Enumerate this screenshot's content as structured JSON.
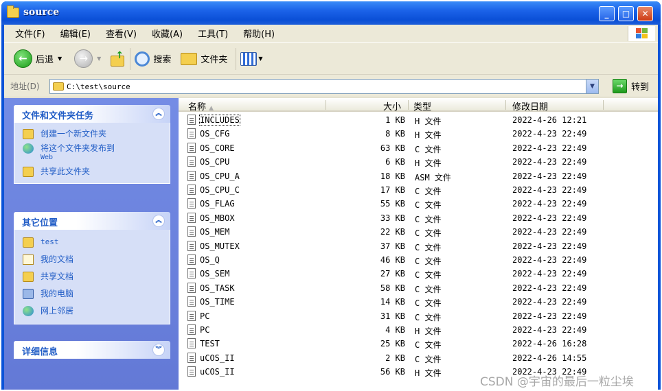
{
  "window": {
    "title": "source",
    "controls": [
      "minimize",
      "maximize",
      "close"
    ]
  },
  "menu": {
    "items": [
      "文件(F)",
      "编辑(E)",
      "查看(V)",
      "收藏(A)",
      "工具(T)",
      "帮助(H)"
    ]
  },
  "toolbar": {
    "back_label": "后退",
    "search_label": "搜索",
    "folders_label": "文件夹"
  },
  "address": {
    "label": "地址(D)",
    "path": "C:\\test\\source",
    "go_label": "转到"
  },
  "tasks_panel": {
    "title": "文件和文件夹任务",
    "items": [
      {
        "label": "创建一个新文件夹",
        "icon": "new-folder-icon"
      },
      {
        "label": "将这个文件夹发布到",
        "sub": "Web",
        "icon": "publish-web-icon"
      },
      {
        "label": "共享此文件夹",
        "icon": "share-folder-icon"
      }
    ]
  },
  "places_panel": {
    "title": "其它位置",
    "items": [
      {
        "label": "test",
        "icon": "folder-icon"
      },
      {
        "label": "我的文档",
        "icon": "documents-icon"
      },
      {
        "label": "共享文档",
        "icon": "folder-icon"
      },
      {
        "label": "我的电脑",
        "icon": "computer-icon"
      },
      {
        "label": "网上邻居",
        "icon": "network-icon"
      }
    ]
  },
  "details_panel": {
    "title": "详细信息"
  },
  "columns": {
    "name": "名称",
    "size": "大小",
    "type": "类型",
    "modified": "修改日期"
  },
  "files": [
    {
      "name": "INCLUDES",
      "size": "1 KB",
      "type": "H 文件",
      "modified": "2022-4-26 12:21"
    },
    {
      "name": "OS_CFG",
      "size": "8 KB",
      "type": "H 文件",
      "modified": "2022-4-23 22:49"
    },
    {
      "name": "OS_CORE",
      "size": "63 KB",
      "type": "C 文件",
      "modified": "2022-4-23 22:49"
    },
    {
      "name": "OS_CPU",
      "size": "6 KB",
      "type": "H 文件",
      "modified": "2022-4-23 22:49"
    },
    {
      "name": "OS_CPU_A",
      "size": "18 KB",
      "type": "ASM 文件",
      "modified": "2022-4-23 22:49"
    },
    {
      "name": "OS_CPU_C",
      "size": "17 KB",
      "type": "C 文件",
      "modified": "2022-4-23 22:49"
    },
    {
      "name": "OS_FLAG",
      "size": "55 KB",
      "type": "C 文件",
      "modified": "2022-4-23 22:49"
    },
    {
      "name": "OS_MBOX",
      "size": "33 KB",
      "type": "C 文件",
      "modified": "2022-4-23 22:49"
    },
    {
      "name": "OS_MEM",
      "size": "22 KB",
      "type": "C 文件",
      "modified": "2022-4-23 22:49"
    },
    {
      "name": "OS_MUTEX",
      "size": "37 KB",
      "type": "C 文件",
      "modified": "2022-4-23 22:49"
    },
    {
      "name": "OS_Q",
      "size": "46 KB",
      "type": "C 文件",
      "modified": "2022-4-23 22:49"
    },
    {
      "name": "OS_SEM",
      "size": "27 KB",
      "type": "C 文件",
      "modified": "2022-4-23 22:49"
    },
    {
      "name": "OS_TASK",
      "size": "58 KB",
      "type": "C 文件",
      "modified": "2022-4-23 22:49"
    },
    {
      "name": "OS_TIME",
      "size": "14 KB",
      "type": "C 文件",
      "modified": "2022-4-23 22:49"
    },
    {
      "name": "PC",
      "size": "31 KB",
      "type": "C 文件",
      "modified": "2022-4-23 22:49"
    },
    {
      "name": "PC",
      "size": "4 KB",
      "type": "H 文件",
      "modified": "2022-4-23 22:49"
    },
    {
      "name": "TEST",
      "size": "25 KB",
      "type": "C 文件",
      "modified": "2022-4-26 16:28"
    },
    {
      "name": "uCOS_II",
      "size": "2 KB",
      "type": "C 文件",
      "modified": "2022-4-26 14:55"
    },
    {
      "name": "uCOS_II",
      "size": "56 KB",
      "type": "H 文件",
      "modified": "2022-4-23 22:49"
    }
  ],
  "watermark": "CSDN @宇宙的最后一粒尘埃",
  "colors": {
    "titlebar": "#0a53d8",
    "task_pane": "#6379d6",
    "link": "#215dc6"
  }
}
